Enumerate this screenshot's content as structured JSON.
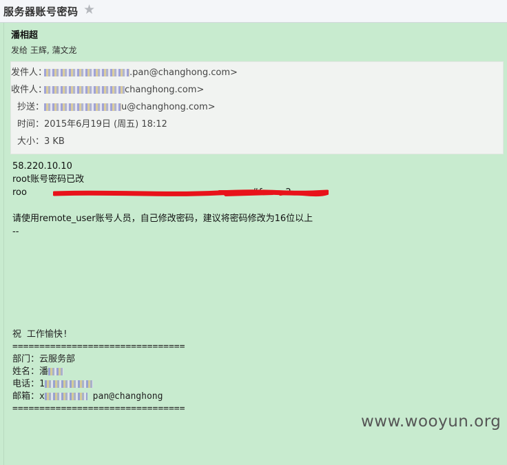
{
  "header": {
    "subject": "服务器账号密码",
    "star_icon": "star-icon"
  },
  "mail": {
    "sender_name": "潘相超",
    "sent_to": "发给 王辉, 蒲文龙",
    "meta": {
      "from_label": "发件人：",
      "from_value": ".pan@changhong.com>",
      "to_label": "收件人：",
      "to_value": "changhong.com>",
      "cc_label": "抄送：",
      "cc_value": "u@changhong.com>",
      "time_label": "时间：",
      "time_value": "2015年6月19日 (周五) 18:12",
      "size_label": "大小：",
      "size_value": "3 KB"
    },
    "body": {
      "ip": "58.220.10.10",
      "line2": "root账号密码已改",
      "line3": "roo",
      "line3_tail": "#f",
      "line3_end": "2~",
      "line5": "请使用remote_user账号人员，自己修改密码，建议将密码修改为16位以上",
      "line6": "--"
    },
    "signature": {
      "greeting": "祝  工作愉快!",
      "divider": "================================",
      "dept": "部门：云服务部",
      "name_label": "姓名：",
      "name_value": "潘",
      "phone_label": "电话：",
      "phone_value": "1",
      "email_label": "邮箱：",
      "email_value_a": "x",
      "email_value_b": "pan@changhong",
      "divider2": "================================"
    }
  },
  "watermark": "www.wooyun.org"
}
